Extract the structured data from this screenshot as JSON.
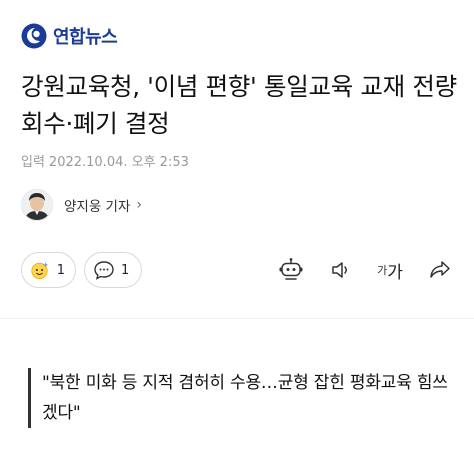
{
  "brand": {
    "name": "연합뉴스"
  },
  "article": {
    "title": "강원교육청, '이념 편향' 통일교육 교재 전량 회수·폐기 결정",
    "meta_label": "입력",
    "meta_datetime": "2022.10.04. 오후 2:53",
    "reporter": "양지웅 기자",
    "subheading": "\"북한 미화 등 지적 겸허히 수용…균형 잡힌 평화교육 힘쓰겠다\""
  },
  "actions": {
    "reaction_count": "1",
    "comment_count": "1",
    "font_size_small": "가",
    "font_size_large": "가"
  },
  "icons": {
    "reaction": "emoji-reaction-icon",
    "comment": "comment-bubble-icon",
    "summary": "robot-summary-icon",
    "audio": "speaker-icon",
    "share": "share-icon",
    "byline_arrow": "chevron-right-icon"
  },
  "colors": {
    "brand": "#1b3b97",
    "text": "#111111",
    "meta": "#999999"
  }
}
